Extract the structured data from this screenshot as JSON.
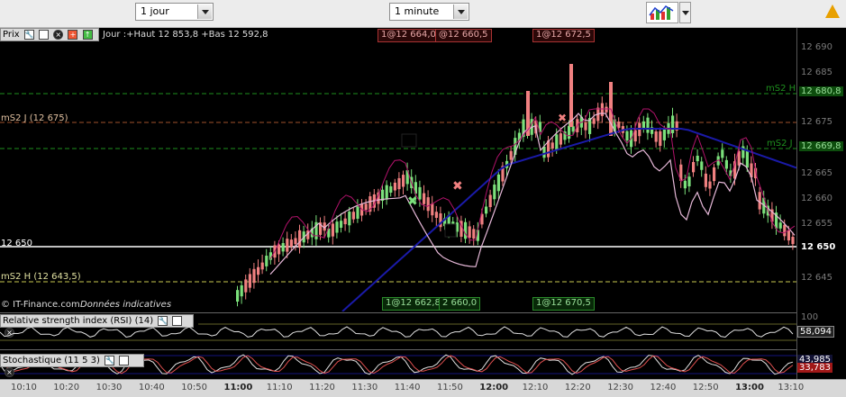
{
  "toolbar": {
    "period_select": "1 jour",
    "interval_select": "1 minute",
    "chart_tool_icon": "chart-icon",
    "warning_icon": "warning-icon"
  },
  "main_panel": {
    "title": "Prix",
    "info": "Jour :+Haut 12 853,8 +Bas 12 592,8",
    "top_labels": [
      "1@12 664,0",
      "@12 660,5",
      "1@12 672,5"
    ],
    "bottom_labels": [
      "1@12 662,8",
      "2 660,0",
      "1@12 670,5"
    ],
    "left_labels": {
      "ms2j": "mS2 J (12 675)",
      "level": "12 650",
      "ms2h": "mS2 H (12 643,5)"
    },
    "copyright": "© IT-Finance.com",
    "disclaimer": "Données indicatives",
    "right_tags": {
      "ms2h_tag": "mS2 H",
      "ms2h_value": "12 680,8",
      "ms2j_tag": "mS2 J",
      "ms2j_value": "12 669,8"
    },
    "y_axis": [
      "12 690",
      "12 685",
      "12 680",
      "12 675",
      "12 670",
      "12 665",
      "12 660",
      "12 655",
      "12 650",
      "12 645"
    ],
    "current_level": "12 650"
  },
  "rsi_panel": {
    "title": "Relative strength index (RSI) (14)",
    "axis_top": "100",
    "value": "58,094"
  },
  "stoch_panel": {
    "title": "Stochastique (11 5 3)",
    "value_a": "43,985",
    "value_b": "33,783"
  },
  "x_axis": [
    "10:10",
    "10:20",
    "10:30",
    "10:40",
    "10:50",
    "11:00",
    "11:10",
    "11:20",
    "11:30",
    "11:40",
    "11:50",
    "12:00",
    "12:10",
    "12:20",
    "12:30",
    "12:40",
    "12:50",
    "13:00",
    "13:10"
  ],
  "x_axis_bold": [
    "11:00",
    "12:00",
    "13:00"
  ],
  "colors": {
    "bull_candle": "#7be07b",
    "bear_candle": "#f08080",
    "dashed_green": "#1e8f1e",
    "dashed_orange": "#a0522d",
    "dashed_yellow": "#c9c94f",
    "ma_blue": "#1a1aa8",
    "ma_pink": "#e6b8d8",
    "band_magenta": "#b0126a"
  }
}
